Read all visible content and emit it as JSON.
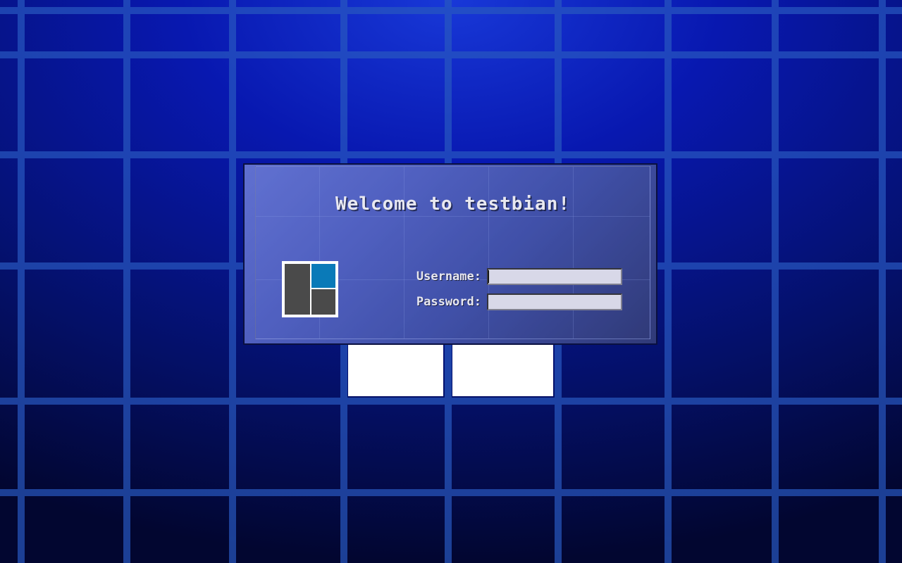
{
  "login": {
    "title": "Welcome to testbian!",
    "username_label": "Username:",
    "password_label": "Password:",
    "username_value": "",
    "password_value": ""
  }
}
